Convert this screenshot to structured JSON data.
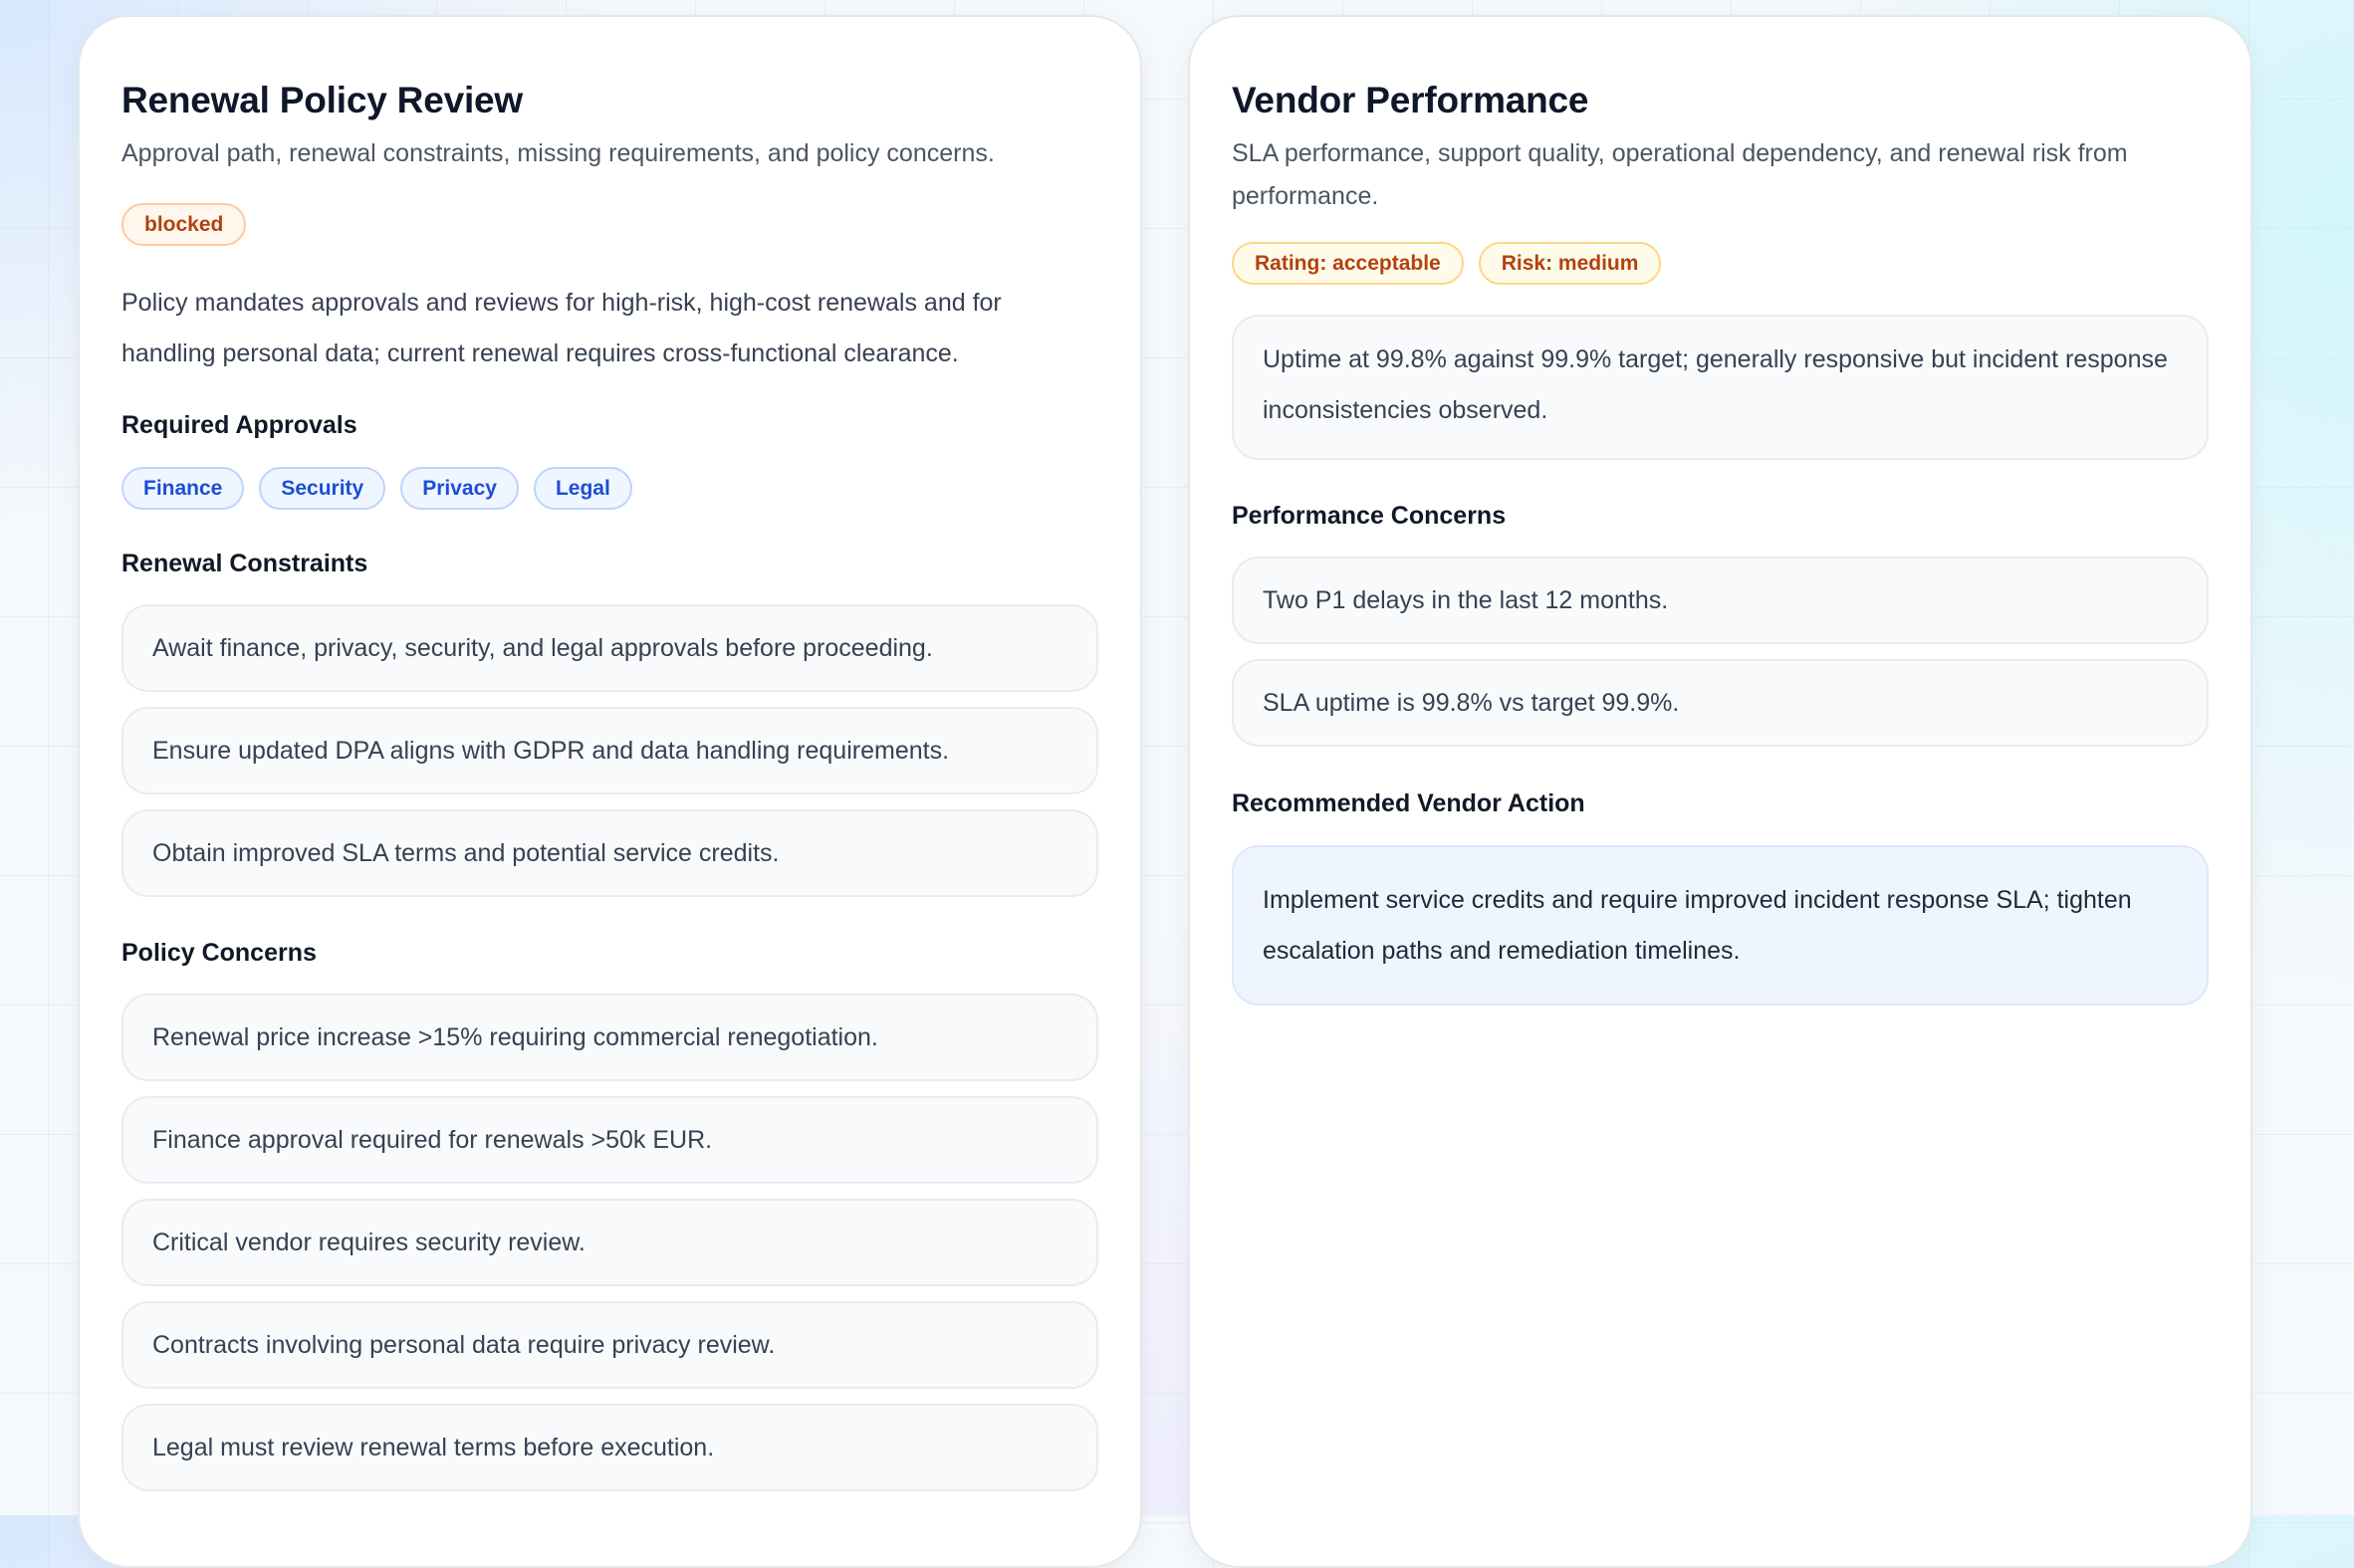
{
  "policy_review": {
    "title": "Renewal Policy Review",
    "subtitle": "Approval path, renewal constraints, missing requirements, and policy concerns.",
    "status": "blocked",
    "summary": "Policy mandates approvals and reviews for high-risk, high-cost renewals and for handling personal data; current renewal requires cross-functional clearance.",
    "required_approvals_title": "Required Approvals",
    "required_approvals": [
      "Finance",
      "Security",
      "Privacy",
      "Legal"
    ],
    "constraints_title": "Renewal Constraints",
    "constraints": [
      "Await finance, privacy, security, and legal approvals before proceeding.",
      "Ensure updated DPA aligns with GDPR and data handling requirements.",
      "Obtain improved SLA terms and potential service credits."
    ],
    "concerns_title": "Policy Concerns",
    "concerns": [
      "Renewal price increase >15% requiring commercial renegotiation.",
      "Finance approval required for renewals >50k EUR.",
      "Critical vendor requires security review.",
      "Contracts involving personal data require privacy review.",
      "Legal must review renewal terms before execution."
    ]
  },
  "vendor_performance": {
    "title": "Vendor Performance",
    "subtitle": "SLA performance, support quality, operational dependency, and renewal risk from performance.",
    "rating_badge": "Rating: acceptable",
    "risk_badge": "Risk: medium",
    "summary": "Uptime at 99.8% against 99.9% target; generally responsive but incident response inconsistencies observed.",
    "concerns_title": "Performance Concerns",
    "concerns": [
      "Two P1 delays in the last 12 months.",
      "SLA uptime is 99.8% vs target 99.9%."
    ],
    "action_title": "Recommended Vendor Action",
    "action": "Implement service credits and require improved incident response SLA; tighten escalation paths and remediation timelines."
  },
  "colors": {
    "blocked_badge": "#b1430f",
    "approval_chip": "#1d4ed8",
    "risk_badge": "#b3420e",
    "action_background": "#eff5ff"
  }
}
